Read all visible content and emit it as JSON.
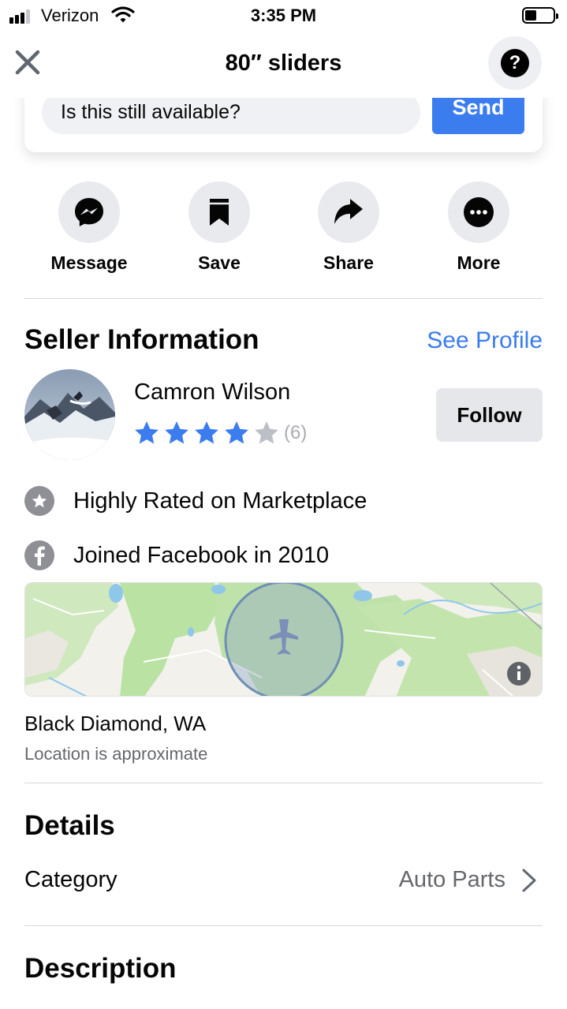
{
  "status_bar": {
    "carrier": "Verizon",
    "time": "3:35 PM"
  },
  "nav": {
    "title": "80″ sliders",
    "help_glyph": "?"
  },
  "message": {
    "input_value": "Is this still available?",
    "send_label": "Send"
  },
  "actions": [
    {
      "label": "Message",
      "icon": "messenger-icon"
    },
    {
      "label": "Save",
      "icon": "bookmark-icon"
    },
    {
      "label": "Share",
      "icon": "share-arrow-icon"
    },
    {
      "label": "More",
      "icon": "more-dots-icon"
    }
  ],
  "seller": {
    "section_title": "Seller Information",
    "see_profile": "See Profile",
    "name": "Camron Wilson",
    "rating": 4,
    "rating_max": 5,
    "review_count": "(6)",
    "follow_label": "Follow",
    "badges": [
      {
        "text": "Highly Rated on Marketplace",
        "icon": "star-badge-icon"
      },
      {
        "text": "Joined Facebook in 2010",
        "icon": "facebook-icon"
      }
    ]
  },
  "location": {
    "name": "Black Diamond, WA",
    "note": "Location is approximate"
  },
  "details": {
    "title": "Details",
    "category_label": "Category",
    "category_value": "Auto Parts"
  },
  "description": {
    "title": "Description"
  },
  "colors": {
    "accent": "#3b7cef",
    "star_on": "#3b7cef",
    "star_off": "#bcc0c6"
  }
}
